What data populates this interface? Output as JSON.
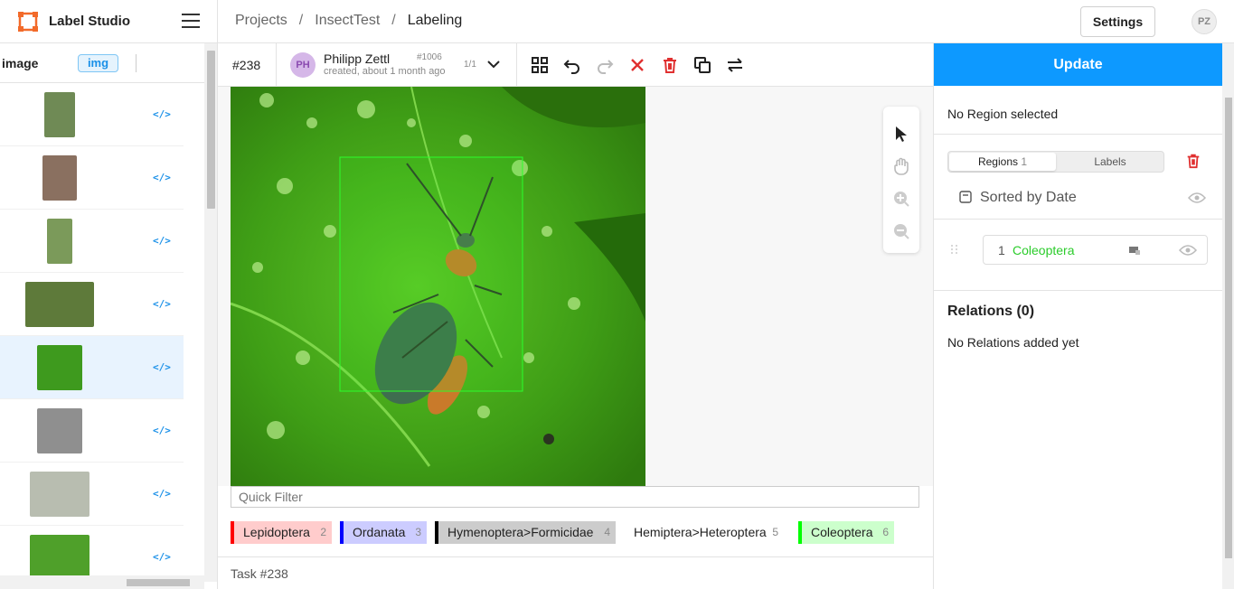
{
  "app": {
    "name": "Label Studio"
  },
  "breadcrumb": [
    "Projects",
    "InsectTest",
    "Labeling"
  ],
  "topbar": {
    "settings_label": "Settings",
    "user_initials": "PZ"
  },
  "task_list": {
    "column_label": "image",
    "badge": "img",
    "code_icon": "</>",
    "rows": [
      {
        "thumb_color": "#6f8a55"
      },
      {
        "thumb_color": "#8a7060"
      },
      {
        "thumb_color": "#7b9a5a"
      },
      {
        "thumb_color": "#5e7a3a"
      },
      {
        "thumb_color": "#3e9a1e",
        "selected": true
      },
      {
        "thumb_color": "#8f8f8f"
      },
      {
        "thumb_color": "#b8bdb0"
      },
      {
        "thumb_color": "#4fa02a"
      }
    ]
  },
  "toolbar": {
    "task_id": "#238",
    "annotator_initials": "PH",
    "annotator_name": "Philipp Zettl",
    "annotation_id": "#1006",
    "annotation_meta": "created, about 1 month ago",
    "annotation_count": "1/1"
  },
  "quick_filter": {
    "placeholder": "Quick Filter"
  },
  "labels": [
    {
      "name": "Lepidoptera",
      "hotkey": "2",
      "color": "#ff0000",
      "bg": "#ffcccc"
    },
    {
      "name": "Ordanata",
      "hotkey": "3",
      "color": "#0000ff",
      "bg": "#ccccff"
    },
    {
      "name": "Hymenoptera>Formicidae",
      "hotkey": "4",
      "color": "#000000",
      "bg": "#cccccc"
    },
    {
      "name": "Hemiptera>Heteroptera",
      "hotkey": "5",
      "color": "#ffffff",
      "bg": "#ffffff"
    },
    {
      "name": "Coleoptera",
      "hotkey": "6",
      "color": "#00ff00",
      "bg": "#ccffcc"
    }
  ],
  "footer": {
    "task_label": "Task #238"
  },
  "sidebar": {
    "update_label": "Update",
    "no_region": "No Region selected",
    "tab_regions": "Regions",
    "tab_regions_count": "1",
    "tab_labels": "Labels",
    "sorted_by": "Sorted by Date",
    "regions": [
      {
        "index": "1",
        "label": "Coleoptera",
        "color": "#2bcc2b"
      }
    ],
    "relations_title": "Relations (0)",
    "relations_empty": "No Relations added yet"
  }
}
